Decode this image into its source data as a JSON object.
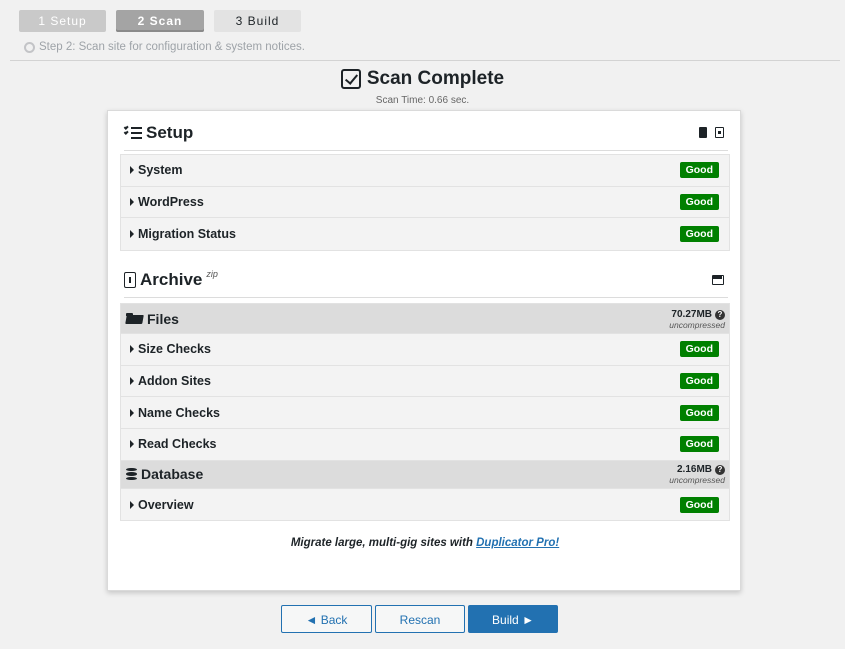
{
  "steps": [
    {
      "label": "1 Setup"
    },
    {
      "label": "2 Scan"
    },
    {
      "label": "3 Build"
    }
  ],
  "step_hint": "Step 2: Scan site for configuration & system notices.",
  "heading": {
    "title": "Scan Complete",
    "scan_time": "Scan Time: 0.66 sec."
  },
  "setup": {
    "title": "Setup",
    "rows": [
      {
        "label": "System",
        "status": "Good"
      },
      {
        "label": "WordPress",
        "status": "Good"
      },
      {
        "label": "Migration Status",
        "status": "Good"
      }
    ]
  },
  "archive": {
    "title": "Archive",
    "subtitle": "zip",
    "files": {
      "title": "Files",
      "size": "70.27MB",
      "size_note": "uncompressed",
      "rows": [
        {
          "label": "Size Checks",
          "status": "Good"
        },
        {
          "label": "Addon Sites",
          "status": "Good"
        },
        {
          "label": "Name Checks",
          "status": "Good"
        },
        {
          "label": "Read Checks",
          "status": "Good"
        }
      ]
    },
    "database": {
      "title": "Database",
      "size": "2.16MB",
      "size_note": "uncompressed",
      "rows": [
        {
          "label": "Overview",
          "status": "Good"
        }
      ]
    }
  },
  "promo": {
    "text": "Migrate large, multi-gig sites with ",
    "link": "Duplicator Pro!"
  },
  "buttons": {
    "back": "◄ Back",
    "rescan": "Rescan",
    "build": "Build ►"
  },
  "colors": {
    "good_badge": "#008000",
    "primary": "#2271b1"
  }
}
